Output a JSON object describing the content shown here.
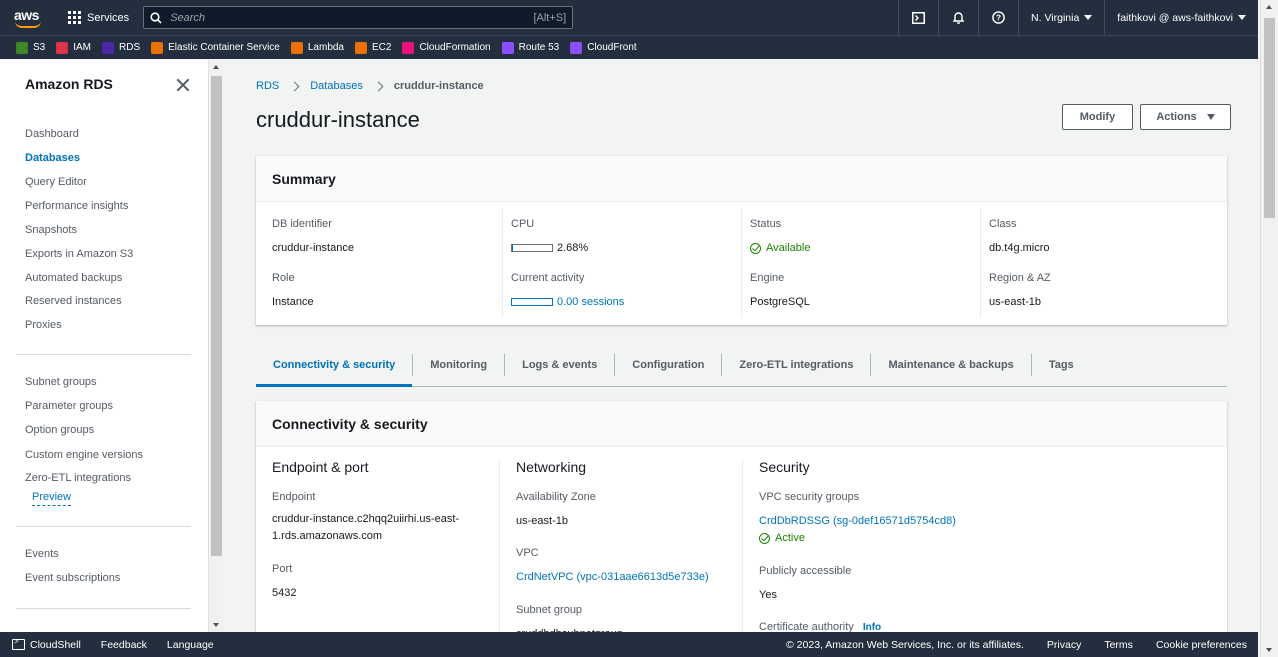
{
  "topnav": {
    "logo": "aws",
    "services_label": "Services",
    "search_placeholder": "Search",
    "search_shortcut": "[Alt+S]",
    "region": "N. Virginia",
    "account": "faithkovi @ aws-faithkovi"
  },
  "favorites": [
    {
      "label": "S3",
      "color": "#3f8624"
    },
    {
      "label": "IAM",
      "color": "#dd344c"
    },
    {
      "label": "RDS",
      "color": "#4d27aa"
    },
    {
      "label": "Elastic Container Service",
      "color": "#ed7100"
    },
    {
      "label": "Lambda",
      "color": "#ed7100"
    },
    {
      "label": "EC2",
      "color": "#ed7100"
    },
    {
      "label": "CloudFormation",
      "color": "#e7157b"
    },
    {
      "label": "Route 53",
      "color": "#8c4fff"
    },
    {
      "label": "CloudFront",
      "color": "#8c4fff"
    }
  ],
  "sidebar": {
    "title": "Amazon RDS",
    "items": [
      "Dashboard",
      "Databases",
      "Query Editor",
      "Performance insights",
      "Snapshots",
      "Exports in Amazon S3",
      "Automated backups",
      "Reserved instances",
      "Proxies",
      "Subnet groups",
      "Parameter groups",
      "Option groups",
      "Custom engine versions",
      "Zero-ETL integrations",
      "Events",
      "Event subscriptions"
    ],
    "preview_label": "Preview"
  },
  "breadcrumb": {
    "root": "RDS",
    "section": "Databases",
    "current": "cruddur-instance"
  },
  "page_title": "cruddur-instance",
  "buttons": {
    "modify": "Modify",
    "actions": "Actions"
  },
  "summary": {
    "title": "Summary",
    "db_identifier_label": "DB identifier",
    "db_identifier": "cruddur-instance",
    "role_label": "Role",
    "role": "Instance",
    "cpu_label": "CPU",
    "cpu_value": "2.68%",
    "cpu_fraction": 0.0268,
    "activity_label": "Current activity",
    "activity_value": "0.00 sessions",
    "status_label": "Status",
    "status": "Available",
    "engine_label": "Engine",
    "engine": "PostgreSQL",
    "class_label": "Class",
    "class": "db.t4g.micro",
    "region_label": "Region & AZ",
    "region": "us-east-1b"
  },
  "tabs": [
    "Connectivity & security",
    "Monitoring",
    "Logs & events",
    "Configuration",
    "Zero-ETL integrations",
    "Maintenance & backups",
    "Tags"
  ],
  "connectivity": {
    "title": "Connectivity & security",
    "endpoint_port": {
      "heading": "Endpoint & port",
      "endpoint_label": "Endpoint",
      "endpoint_line1": "cruddur-instance.c2hqq2uiirhi.us-east-",
      "endpoint_line2": "1.rds.amazonaws.com",
      "port_label": "Port",
      "port": "5432"
    },
    "networking": {
      "heading": "Networking",
      "az_label": "Availability Zone",
      "az": "us-east-1b",
      "vpc_label": "VPC",
      "vpc": "CrdNetVPC (vpc-031aae6613d5e733e)",
      "subnet_label": "Subnet group",
      "subnet": "cruddbdbsubnetgroup"
    },
    "security": {
      "heading": "Security",
      "sg_label": "VPC security groups",
      "sg": "CrdDbRDSSG (sg-0def16571d5754cd8)",
      "sg_status": "Active",
      "public_label": "Publicly accessible",
      "public": "Yes",
      "ca_label": "Certificate authority",
      "ca_info": "Info"
    }
  },
  "footer": {
    "cloudshell": "CloudShell",
    "feedback": "Feedback",
    "language": "Language",
    "copyright": "© 2023, Amazon Web Services, Inc. or its affiliates.",
    "privacy": "Privacy",
    "terms": "Terms",
    "cookies": "Cookie preferences"
  }
}
